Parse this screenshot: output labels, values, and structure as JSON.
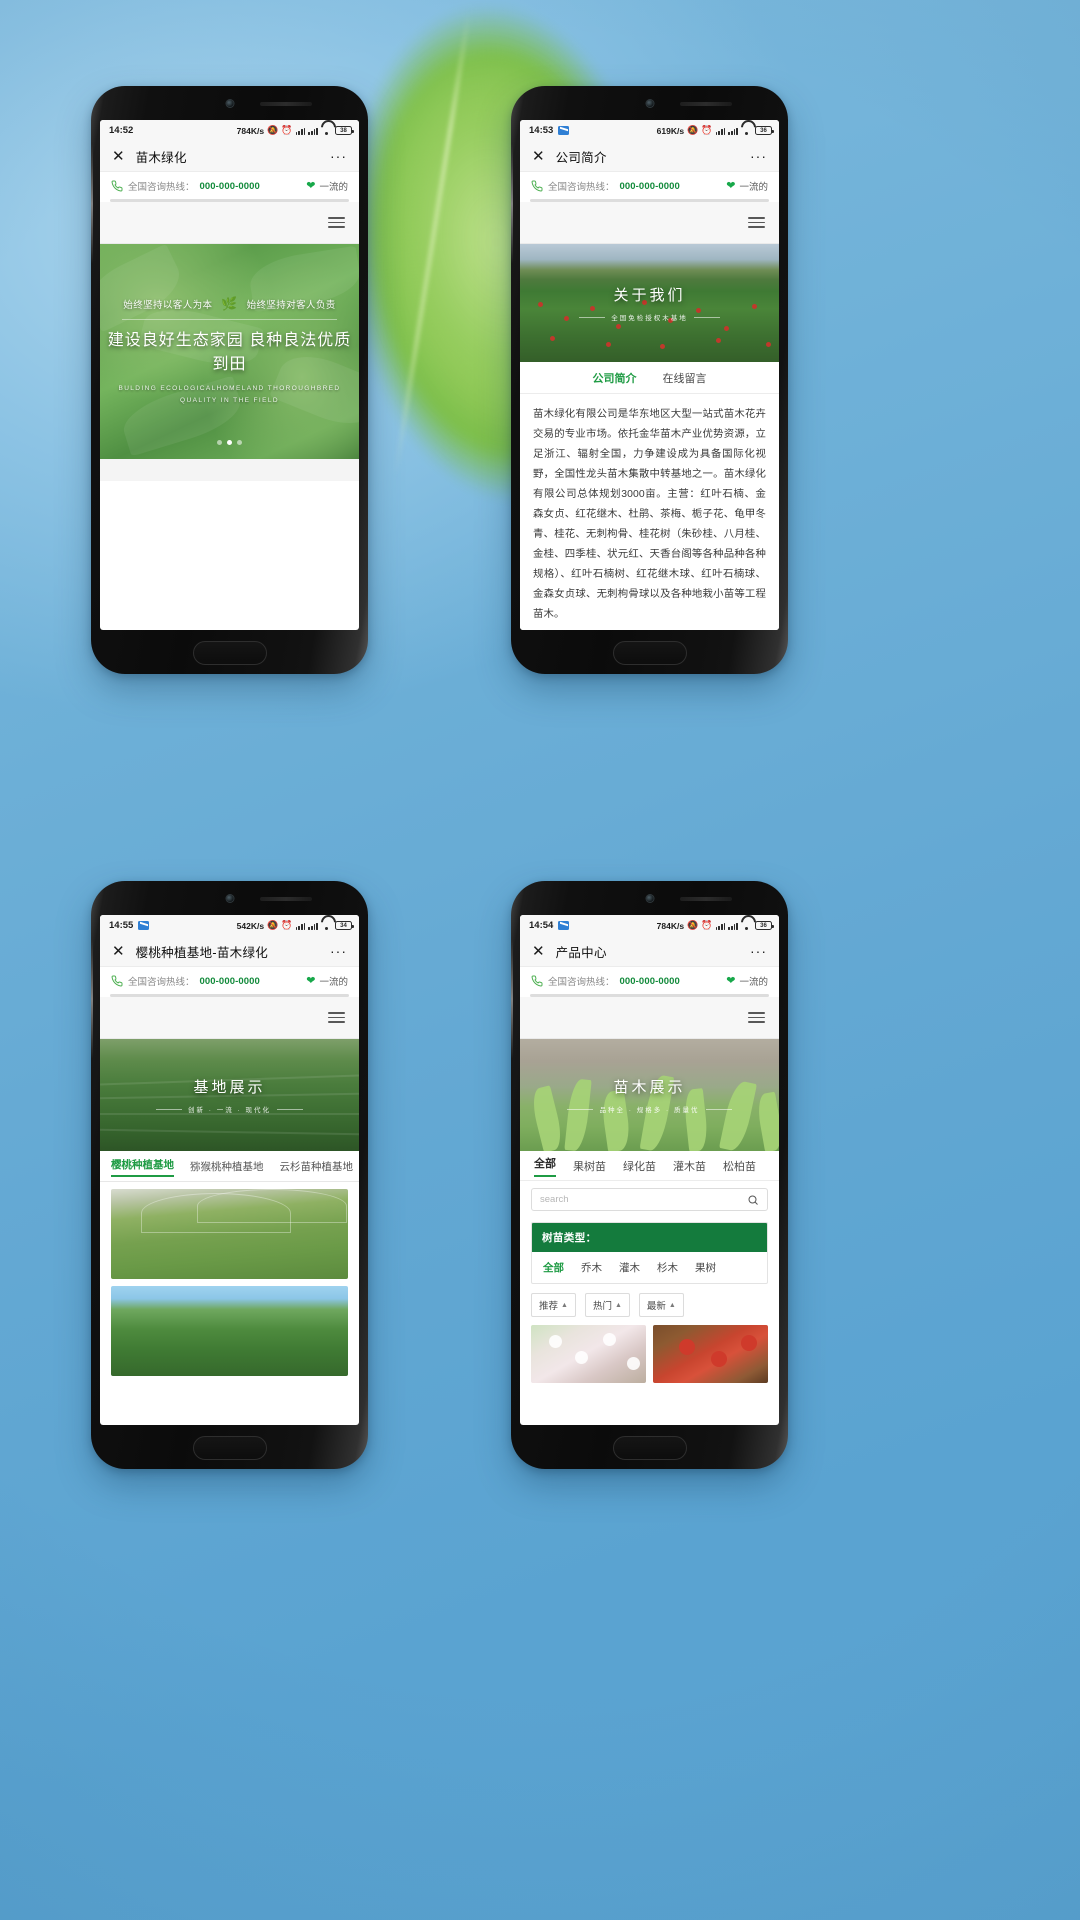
{
  "meta": {
    "canvas": "1080x1920",
    "background_color": "#5aa7d4",
    "accent_green": "#1f9b44",
    "brand_green_dark": "#147b3d",
    "hotline_green": "#118a3a"
  },
  "common": {
    "hotline_label": "全国咨询热线：",
    "hotline_number": "000-000-0000",
    "hotline_slogan": "一流的",
    "phone_icon": "phone-receiver-icon",
    "heart_icon": "heart-icon",
    "menu_icon": "hamburger-menu-icon",
    "close_icon": "close-x-icon",
    "more_icon": "more-dots-icon"
  },
  "phones": [
    {
      "id": "phone-home",
      "status": {
        "time": "14:52",
        "net_speed": "784K/s",
        "mute_icon": "mute-bell-icon",
        "alarm_icon": "alarm-clock-icon",
        "signal_icon": "signal-bars-icon",
        "wifi_icon": "wifi-icon",
        "battery_text": "38",
        "mail_icon": null
      },
      "wx_title": "苗木绿化",
      "hero": {
        "sub_left": "始终坚持以客人为本",
        "sub_right": "始终坚持对客人负责",
        "badge_icon": "tree-badge-icon",
        "main": "建设良好生态家园  良种良法优质到田",
        "en_line1": "BULDING ECOLOGICALHOMELAND THOROUGHBRED",
        "en_line2": "QUALITY IN THE FIELD",
        "dots": 3,
        "active_dot": 1
      }
    },
    {
      "id": "phone-about",
      "status": {
        "time": "14:53",
        "net_speed": "619K/s",
        "mute_icon": "mute-bell-icon",
        "alarm_icon": "alarm-clock-icon",
        "signal_icon": "signal-bars-icon",
        "wifi_icon": "wifi-icon",
        "battery_text": "36",
        "mail_icon": "mail-icon"
      },
      "wx_title": "公司简介",
      "hero": {
        "title": "关于我们",
        "subtitle": "全国免检授权木基地"
      },
      "tabs": [
        {
          "label": "公司简介",
          "active": true
        },
        {
          "label": "在线留言",
          "active": false
        }
      ],
      "body": "苗木绿化有限公司是华东地区大型一站式苗木花卉交易的专业市场。依托金华苗木产业优势资源，立足浙江、辐射全国，力争建设成为具备国际化视野，全国性龙头苗木集散中转基地之一。苗木绿化有限公司总体规划3000亩。主营：红叶石楠、金森女贞、红花继木、杜鹃、茶梅、栀子花、龟甲冬青、桂花、无刺枸骨、桂花树（朱砂桂、八月桂、金桂、四季桂、状元红、天香台阁等各种品种各种规格）、红叶石楠树、红花继木球、红叶石楠球、金森女贞球、无刺枸骨球以及各种地栽小苗等工程苗木。"
    },
    {
      "id": "phone-base",
      "status": {
        "time": "14:55",
        "net_speed": "542K/s",
        "mute_icon": "mute-bell-icon",
        "alarm_icon": "alarm-clock-icon",
        "signal_icon": "signal-bars-icon",
        "wifi_icon": "wifi-icon",
        "battery_text": "34",
        "mail_icon": "mail-icon"
      },
      "wx_title": "樱桃种植基地-苗木绿化",
      "hero": {
        "title": "基地展示",
        "subtitle": "创新 · 一流 · 现代化"
      },
      "tabs": [
        {
          "label": "樱桃种植基地",
          "active": true
        },
        {
          "label": "猕猴桃种植基地",
          "active": false
        },
        {
          "label": "云杉苗种植基地",
          "active": false
        }
      ],
      "gallery": [
        {
          "name": "nursery-greenhouse-photo"
        },
        {
          "name": "conifer-field-photo"
        }
      ]
    },
    {
      "id": "phone-products",
      "status": {
        "time": "14:54",
        "net_speed": "784K/s",
        "mute_icon": "mute-bell-icon",
        "alarm_icon": "alarm-clock-icon",
        "signal_icon": "signal-bars-icon",
        "wifi_icon": "wifi-icon",
        "battery_text": "36",
        "mail_icon": "mail-icon"
      },
      "wx_title": "产品中心",
      "hero": {
        "title": "苗木展示",
        "subtitle": "品种全 · 规格多 · 质量优"
      },
      "tabs": [
        {
          "label": "全部",
          "active": true
        },
        {
          "label": "果树苗",
          "active": false
        },
        {
          "label": "绿化苗",
          "active": false
        },
        {
          "label": "灌木苗",
          "active": false
        },
        {
          "label": "松柏苗",
          "active": false
        }
      ],
      "search": {
        "placeholder": "search",
        "value": "",
        "icon": "search-icon"
      },
      "filter": {
        "heading": "树苗类型：",
        "options": [
          {
            "label": "全部",
            "active": true
          },
          {
            "label": "乔木",
            "active": false
          },
          {
            "label": "灌木",
            "active": false
          },
          {
            "label": "杉木",
            "active": false
          },
          {
            "label": "果树",
            "active": false
          }
        ]
      },
      "sorts": [
        {
          "label": "推荐",
          "caret": "▲"
        },
        {
          "label": "热门",
          "caret": "▲"
        },
        {
          "label": "最新",
          "caret": "▲"
        }
      ],
      "products": [
        {
          "name": "peach-blossom-product"
        },
        {
          "name": "apple-fruit-product"
        }
      ]
    }
  ]
}
